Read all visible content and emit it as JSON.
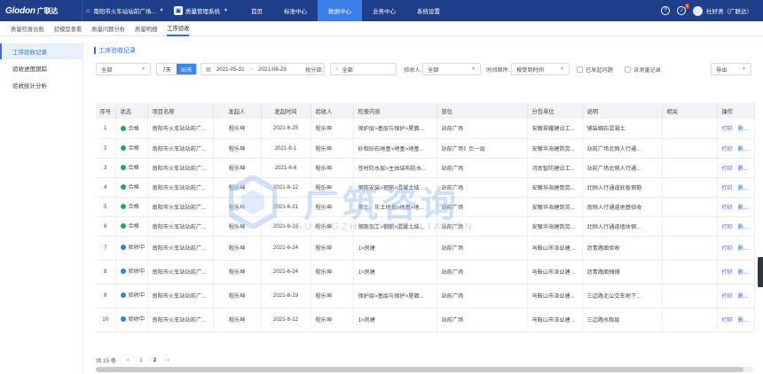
{
  "topbar": {
    "logo": "Glodon",
    "logo_cn": "广联达",
    "project": "南阳市火车站站前广场...",
    "system": "质量管理系统",
    "nav": [
      "首页",
      "标准中心",
      "数据中心",
      "业务中心",
      "系统设置"
    ],
    "active_nav": 2,
    "help_glyph": "?",
    "bell_glyph": "♪",
    "notify_count": "1",
    "user": "杜好贤（广联达）"
  },
  "subtabs": [
    "质量检查台账",
    "验模型查看",
    "质量问题分析",
    "质量明细",
    "工序验收"
  ],
  "active_subtab": 4,
  "sidebar": [
    "工序验收记录",
    "验收进度跟踪",
    "验收统计分析"
  ],
  "active_sidebar": 0,
  "page_title": "工序验收记录",
  "filters": {
    "scope": "全部",
    "quick_7": "7天",
    "quick_30": "30天",
    "date_start": "2021-05-31",
    "date_sep": "~",
    "date_end": "2021-06-29",
    "dept_label": "按分部:",
    "dept_value": "全部",
    "acceptor_label": "验收人:",
    "acceptor_value": "全部",
    "order_label": "时间顺序:",
    "order_value": "按受到时间",
    "chk1": "已发起问题",
    "chk2": "含测量记录",
    "export": "导出"
  },
  "table": {
    "headers": [
      "序号",
      "状态",
      "项目名称",
      "发起人",
      "发起时间",
      "验收人",
      "检查内容",
      "部位",
      "分包单位",
      "说明",
      "相关",
      "操作"
    ],
    "op_view": "打印",
    "op_delete": "删除",
    "rows": [
      {
        "no": "1",
        "status": "合格",
        "status_color": "#1aaa55",
        "project": "南阳市火车站站前广...",
        "initiator": "程乐坤",
        "time": "2021-6-25",
        "acceptor": "程乐坤",
        "content": "保护层>基层与保护>屋面...",
        "location": "站前广场",
        "sub": "安徽翠耀建设工...",
        "note": "铺装细石混凝土"
      },
      {
        "no": "2",
        "status": "合格",
        "status_color": "#1aaa55",
        "project": "南阳市火车站站前广...",
        "initiator": "程乐坤",
        "time": "2021-6-1",
        "acceptor": "程乐坤",
        "content": "砂和砂石地基>地基>地基...",
        "location": "站前广场》负一层",
        "sub": "安徽华海建筑劳...",
        "note": "站前广场北侧人行通..."
      },
      {
        "no": "3",
        "status": "合格",
        "status_color": "#1aaa55",
        "project": "南阳市火车站站前广...",
        "initiator": "程乐坤",
        "time": "2021-6-6",
        "acceptor": "程乐坤",
        "content": "签村防水层>主体结构防水...",
        "location": "站前广场",
        "sub": "河南智防建设工...",
        "note": "站前广场北侧人行通..."
      },
      {
        "no": "4",
        "status": "合格",
        "status_color": "#1aaa55",
        "project": "南阳市火车站站前广...",
        "initiator": "程乐坤",
        "time": "2021-6-12",
        "acceptor": "程乐坤",
        "content": "钢筋安装>钢筋>混凝土结...",
        "location": "站前广场",
        "sub": "安徽华海建筑劳...",
        "note": "北侧人行通道底板钢筋"
      },
      {
        "no": "5",
        "status": "合格",
        "status_color": "#1aaa55",
        "project": "南阳市火车站站前广...",
        "initiator": "程乐坤",
        "time": "2021-6-21",
        "acceptor": "程乐坤",
        "content": "素土、灰土地基>地基>地...",
        "location": "站前广场",
        "sub": "安徽华海建筑劳...",
        "note": "南侧人行通道地基验收"
      },
      {
        "no": "6",
        "status": "合格",
        "status_color": "#1aaa55",
        "project": "南阳市火车站站前广...",
        "initiator": "程乐坤",
        "time": "2021-6-19",
        "acceptor": "程乐坤",
        "content": "钢筋加工>钢筋>混凝土结...",
        "location": "站前广场",
        "sub": "安徽华海建筑劳...",
        "note": "北侧人行通道墙体钢..."
      },
      {
        "no": "7",
        "status": "验收中",
        "status_color": "#2f80ed",
        "project": "南阳市火车站站前广...",
        "initiator": "程乐坤",
        "time": "2021-6-24",
        "acceptor": "程乐坤",
        "content": "1>房建",
        "location": "站前广场",
        "sub": "马鞍山市泽业建...",
        "note": "沥青路面验收"
      },
      {
        "no": "8",
        "status": "验收中",
        "status_color": "#2f80ed",
        "project": "南阳市火车站站前广...",
        "initiator": "程乐坤",
        "time": "2021-6-24",
        "acceptor": "程乐坤",
        "content": "1>房建",
        "location": "站前广场",
        "sub": "马鞍山市泽业建...",
        "note": "沥青路面摊铺"
      },
      {
        "no": "9",
        "status": "验收中",
        "status_color": "#2f80ed",
        "project": "南阳市火车站站前广...",
        "initiator": "程乐坤",
        "time": "2021-6-19",
        "acceptor": "程乐坤",
        "content": "保护层>基层与保护>屋面...",
        "location": "站前广场",
        "sub": "马鞍山市泽业建...",
        "note": "三边路北公交车地下..."
      },
      {
        "no": "10",
        "status": "验收中",
        "status_color": "#2f80ed",
        "project": "南阳市火车站站前广...",
        "initiator": "程乐坤",
        "time": "2021-6-12",
        "acceptor": "程乐坤",
        "content": "1>房建",
        "location": "站前广场",
        "sub": "马鞍山市泽业建...",
        "note": "三边路水稳层"
      }
    ]
  },
  "pager": {
    "total": "共 15 条",
    "prev": "‹",
    "page1": "1",
    "page2": "2",
    "next": "›"
  },
  "watermark": {
    "cn": "广筑咨询",
    "en": "GUANGZHU CONSULTATION"
  }
}
